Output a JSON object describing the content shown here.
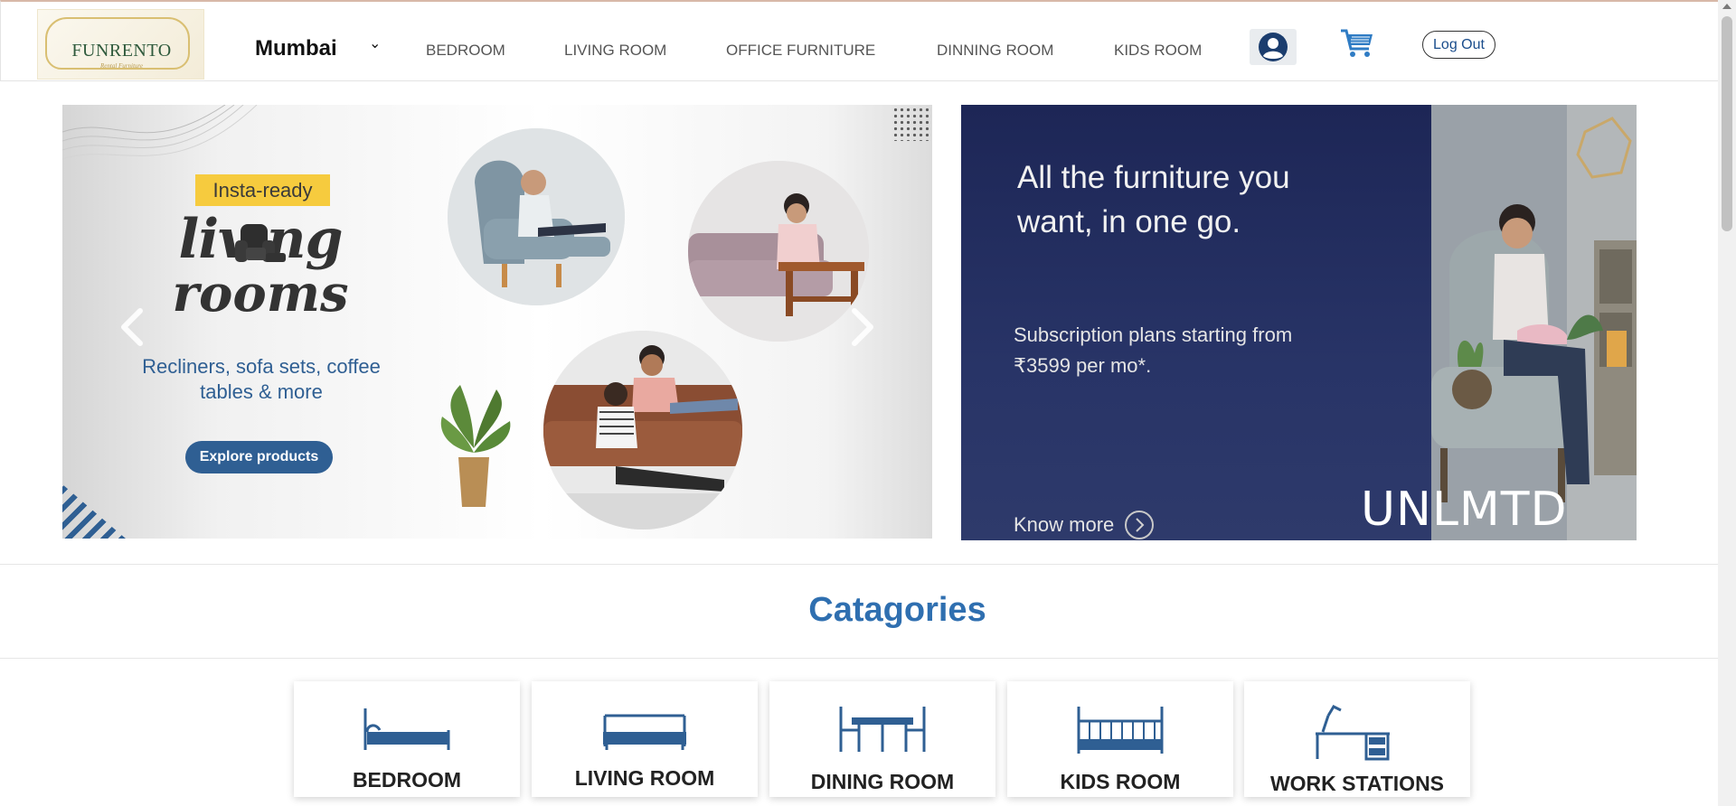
{
  "header": {
    "logo": {
      "name": "FUNRENTO",
      "tagline": "Rental Furniture"
    },
    "city": "Mumbai",
    "nav_links": [
      "BEDROOM",
      "LIVING ROOM",
      "OFFICE FURNITURE",
      "DINNING ROOM",
      "KIDS ROOM"
    ],
    "logout_label": "Log Out"
  },
  "banner_left": {
    "tag": "Insta-ready",
    "headline_line1": "liv  ng",
    "headline_line2": "rooms",
    "subtitle": "Recliners, sofa sets, coffee tables & more",
    "button_label": "Explore products",
    "colors": {
      "accent": "#2f5f93",
      "tag": "#f6cb3e"
    }
  },
  "banner_right": {
    "headline": "All the furniture you want, in one go.",
    "subtitle": "Subscription plans starting from ₹3599 per mo*.",
    "link_label": "Know more",
    "brand": "UNLMTD"
  },
  "categories": {
    "title": "Catagories",
    "items": [
      {
        "label": "BEDROOM",
        "icon": "bed-icon"
      },
      {
        "label": "LIVING ROOM",
        "icon": "sofa-icon"
      },
      {
        "label": "DINING ROOM",
        "icon": "dining-table-icon"
      },
      {
        "label": "KIDS ROOM",
        "icon": "crib-icon"
      },
      {
        "label": "WORK STATIONS",
        "icon": "desk-lamp-icon"
      }
    ]
  },
  "colors": {
    "brand": "#2f6fb0",
    "nav_text": "#555555"
  }
}
